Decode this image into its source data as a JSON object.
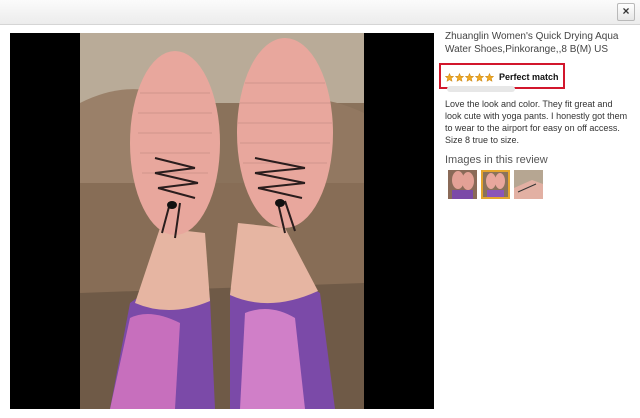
{
  "window": {
    "close_label": "×"
  },
  "panel": {
    "product_title": "Zhuanglin Women's Quick Drying Aqua Water Shoes,Pinkorange,,8 B(M) US",
    "rating": {
      "stars": 5,
      "label": "Perfect match"
    },
    "review_text": "Love the look and color. They fit great and look cute with yoga pants. I honestly got them to wear to the airport for easy on off access. Size 8 true to size.",
    "images_heading": "Images in this review",
    "thumbnail_count": 3,
    "selected_thumbnail": 2
  },
  "colors": {
    "highlight": "#d2172c",
    "star": "#f0a81f",
    "selected_thumb_border": "#e4a52e"
  }
}
